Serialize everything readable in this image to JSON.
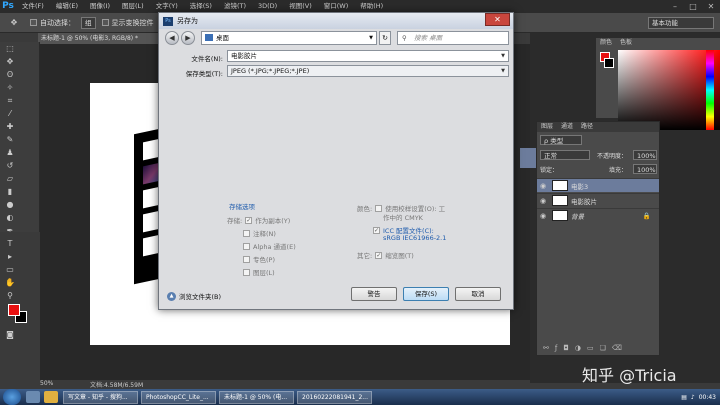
{
  "app": {
    "logo": "Ps",
    "menu": [
      "文件(F)",
      "编辑(E)",
      "图像(I)",
      "图层(L)",
      "文字(Y)",
      "选择(S)",
      "滤镜(T)",
      "3D(D)",
      "视图(V)",
      "窗口(W)",
      "帮助(H)"
    ],
    "options": {
      "auto_select_label": "自动选择：",
      "auto_select_value": "组",
      "show_transform_label": "显示变换控件"
    },
    "workspace": "基本功能",
    "doc_tab": "未标题-1 @ 50% (电影3, RGB/8) *",
    "zoom": "50%",
    "doc_info": "文档:4.58M/6.59M"
  },
  "panels": {
    "color_tabs": [
      "颜色",
      "色板"
    ],
    "layers_tabs": [
      "图层",
      "通道",
      "路径"
    ],
    "kind": "ρ 类型",
    "blend": "正常",
    "opacity_label": "不透明度：",
    "opacity": "100%",
    "lock_label": "锁定：",
    "fill_label": "填充：",
    "fill": "100%",
    "layers": [
      {
        "name": "电影3",
        "selected": true
      },
      {
        "name": "电影胶片",
        "selected": false
      },
      {
        "name": "背景",
        "selected": false
      }
    ]
  },
  "dialog": {
    "title": "另存为",
    "address": "桌面",
    "search_placeholder": "搜索 桌面",
    "filename_label": "文件名(N):",
    "filename": "电影胶片",
    "filetype_label": "保存类型(T):",
    "filetype": "JPEG (*.JPG;*.JPEG;*.JPE)",
    "save_options_title": "存储选项",
    "save_label": "存储:",
    "as_copy": "作为副本(Y)",
    "notes": "注释(N)",
    "alpha": "Alpha 通道(E)",
    "spot": "专色(P)",
    "layers_opt": "图层(L)",
    "color_label": "颜色:",
    "proof_setup": "使用校样设置(O): 工",
    "proof_setup_2": "作中的 CMYK",
    "icc": "ICC 配置文件(C):",
    "icc_2": "sRGB IEC61966-2.1",
    "other_label": "其它:",
    "thumbnail": "缩览图(T)",
    "browse": "浏览文件夹(B)",
    "warn_btn": "警告",
    "save_btn": "保存(S)",
    "cancel_btn": "取消"
  },
  "taskbar": {
    "items": [
      "写文章 - 知乎 - 搜狗...",
      "PhotoshopCC_Lite_...",
      "未标题-1 @ 50% (电...",
      "20160222081941_2..."
    ],
    "clock": "00:43"
  },
  "watermark": "知乎 @Tricia"
}
